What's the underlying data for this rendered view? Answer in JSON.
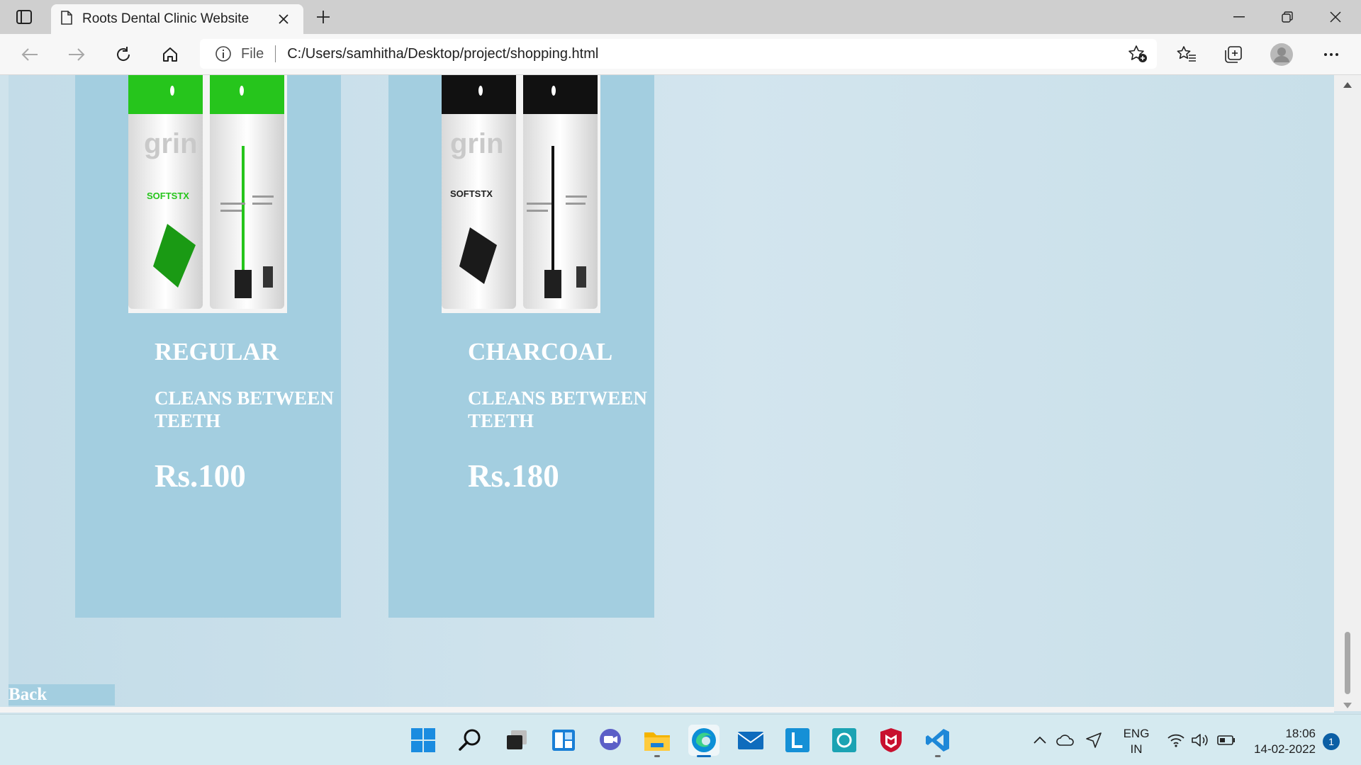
{
  "browser": {
    "tab_title": "Roots Dental Clinic Website",
    "address_prefix": "File",
    "url": "C:/Users/samhitha/Desktop/project/shopping.html"
  },
  "products": [
    {
      "name": "REGULAR",
      "description": "CLEANS BETWEEN TEETH",
      "price": "Rs.100",
      "theme": "green",
      "image_text": {
        "brand": "grin",
        "product": "SOFTSTX"
      }
    },
    {
      "name": "CHARCOAL",
      "description": "CLEANS BETWEEN TEETH",
      "price": "Rs.180",
      "theme": "black",
      "image_text": {
        "brand": "grin",
        "product": "SOFTSTX"
      }
    }
  ],
  "back_label": "Back",
  "colors": {
    "card_bg": "#a3cee0",
    "page_bg": "#cfe3ec",
    "green_accent": "#22c41b",
    "charcoal_accent": "#111111"
  },
  "taskbar": {
    "apps": [
      "windows-start-icon",
      "search-icon",
      "task-view-icon",
      "widgets-icon",
      "teams-chat-icon",
      "file-explorer-icon",
      "edge-icon",
      "mail-icon",
      "lens-app-icon",
      "alexa-icon",
      "mcafee-icon",
      "vscode-icon"
    ],
    "lang_line1": "ENG",
    "lang_line2": "IN",
    "time": "18:06",
    "date": "14-02-2022",
    "notification_count": "1"
  }
}
